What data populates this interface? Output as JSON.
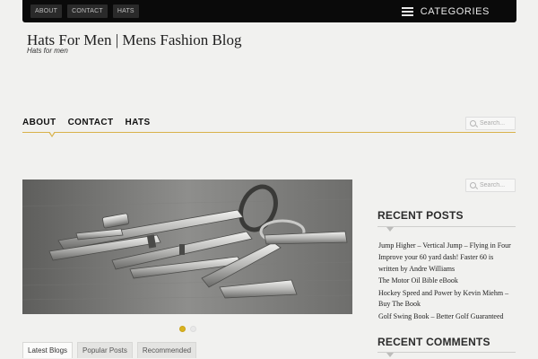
{
  "topbar": {
    "links": [
      "ABOUT",
      "CONTACT",
      "HATS"
    ],
    "categories_label": "CATEGORIES"
  },
  "site": {
    "title": "Hats For Men | Mens Fashion Blog",
    "tagline": "Hats for men"
  },
  "main_nav": {
    "items": [
      "ABOUT",
      "CONTACT",
      "HATS"
    ]
  },
  "search": {
    "placeholder": "Search..."
  },
  "slider": {
    "image": "keys-photo",
    "dots": [
      true,
      false
    ]
  },
  "tabs": [
    "Latest Blogs",
    "Popular Posts",
    "Recommended"
  ],
  "sidebar": {
    "recent_posts_title": "RECENT POSTS",
    "recent_posts": [
      "Jump Higher – Vertical Jump – Flying in Four",
      "Improve your 60 yard dash! Faster 60 is written by Andre Williams",
      "The Motor Oil Bible eBook",
      "Hockey Speed and Power by Kevin Miehm – Buy The Book",
      "Golf Swing Book – Better Golf Guaranteed"
    ],
    "recent_comments_title": "RECENT COMMENTS"
  },
  "colors": {
    "accent": "#d9b24a",
    "topbar": "#0a0a0a",
    "background": "#f1f1ef"
  }
}
